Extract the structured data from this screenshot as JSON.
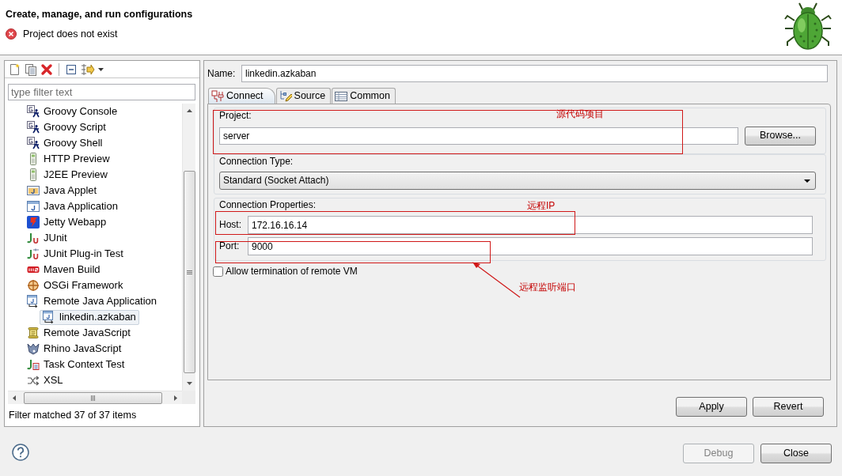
{
  "header": {
    "title": "Create, manage, and run configurations",
    "message": {
      "kind": "error",
      "text": "Project does not exist"
    }
  },
  "left_panel": {
    "filter": {
      "placeholder": "type filter text"
    },
    "tree": [
      {
        "label": "Groovy Console",
        "kind": "groovy",
        "selected": false
      },
      {
        "label": "Groovy Script",
        "kind": "groovy",
        "selected": false
      },
      {
        "label": "Groovy Shell",
        "kind": "groovy",
        "selected": false
      },
      {
        "label": "HTTP Preview",
        "kind": "preview",
        "selected": false
      },
      {
        "label": "J2EE Preview",
        "kind": "preview",
        "selected": false
      },
      {
        "label": "Java Applet",
        "kind": "applet",
        "selected": false
      },
      {
        "label": "Java Application",
        "kind": "java-app",
        "selected": false
      },
      {
        "label": "Jetty Webapp",
        "kind": "jetty",
        "selected": false
      },
      {
        "label": "JUnit",
        "kind": "junit",
        "selected": false
      },
      {
        "label": "JUnit Plug-in Test",
        "kind": "junit-plugin",
        "selected": false
      },
      {
        "label": "Maven Build",
        "kind": "maven",
        "selected": false
      },
      {
        "label": "OSGi Framework",
        "kind": "osgi",
        "selected": false
      },
      {
        "label": "Remote Java Application",
        "kind": "remote-java",
        "selected": false,
        "children": [
          {
            "label": "linkedin.azkaban",
            "kind": "remote-java",
            "selected": true
          }
        ]
      },
      {
        "label": "Remote JavaScript",
        "kind": "remote-js",
        "selected": false
      },
      {
        "label": "Rhino JavaScript",
        "kind": "rhino",
        "selected": false
      },
      {
        "label": "Task Context Test",
        "kind": "task",
        "selected": false
      },
      {
        "label": "XSL",
        "kind": "xsl",
        "selected": false
      }
    ],
    "status": "Filter matched 37 of 37 items"
  },
  "right_panel": {
    "name": {
      "label": "Name:",
      "value": "linkedin.azkaban"
    },
    "tabs": [
      {
        "label": "Connect",
        "selected": true
      },
      {
        "label": "Source",
        "selected": false
      },
      {
        "label": "Common",
        "selected": false
      }
    ],
    "project": {
      "label": "Project:",
      "value": "server",
      "button": "Browse..."
    },
    "connection_type": {
      "label": "Connection Type:",
      "value": "Standard (Socket Attach)"
    },
    "connection_properties": {
      "label": "Connection Properties:",
      "fields": [
        {
          "label": "Host:",
          "value": "172.16.16.14"
        },
        {
          "label": "Port:",
          "value": "9000"
        }
      ]
    },
    "allow_termination": {
      "label": "Allow termination of remote VM",
      "checked": false
    },
    "buttons": [
      "Apply",
      "Revert"
    ]
  },
  "footer": {
    "buttons": [
      {
        "label": "Debug",
        "disabled": true
      },
      {
        "label": "Close",
        "disabled": false
      }
    ]
  },
  "annotations": [
    {
      "kind": "box",
      "text": "源代码项目"
    },
    {
      "kind": "box",
      "text": "远程IP"
    },
    {
      "kind": "arrow",
      "text": "远程监听端口"
    }
  ]
}
